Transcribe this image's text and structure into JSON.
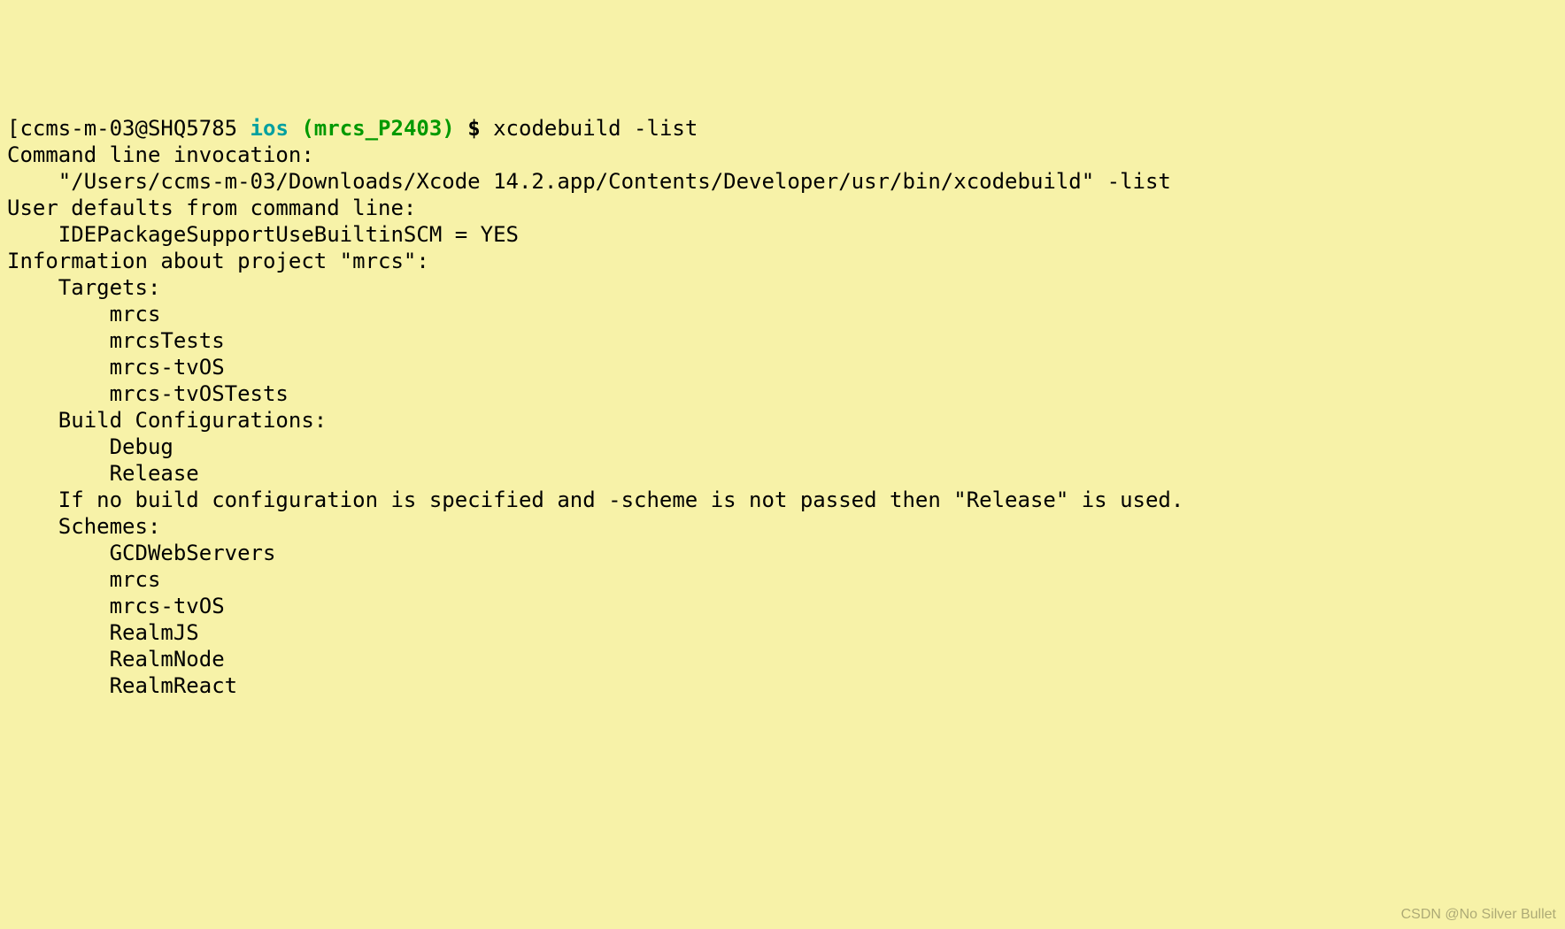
{
  "prompt": {
    "bracket": "[",
    "host": "ccms-m-03@SHQ5785",
    "dir": "ios",
    "branch": "(mrcs_P2403)",
    "dollar": "$",
    "command": "xcodebuild -list"
  },
  "output": {
    "line1": "Command line invocation:",
    "line2": "    \"/Users/ccms-m-03/Downloads/Xcode 14.2.app/Contents/Developer/usr/bin/xcodebuild\" -list",
    "line3": "",
    "line4": "User defaults from command line:",
    "line5": "    IDEPackageSupportUseBuiltinSCM = YES",
    "line6": "",
    "line7": "Information about project \"mrcs\":",
    "line8": "    Targets:",
    "line9": "        mrcs",
    "line10": "        mrcsTests",
    "line11": "        mrcs-tvOS",
    "line12": "        mrcs-tvOSTests",
    "line13": "",
    "line14": "    Build Configurations:",
    "line15": "        Debug",
    "line16": "        Release",
    "line17": "",
    "line18": "    If no build configuration is specified and -scheme is not passed then \"Release\" is used.",
    "line19": "",
    "line20": "    Schemes:",
    "line21": "        GCDWebServers",
    "line22": "        mrcs",
    "line23": "        mrcs-tvOS",
    "line24": "        RealmJS",
    "line25": "        RealmNode",
    "line26": "        RealmReact"
  },
  "watermark": "CSDN @No Silver Bullet"
}
